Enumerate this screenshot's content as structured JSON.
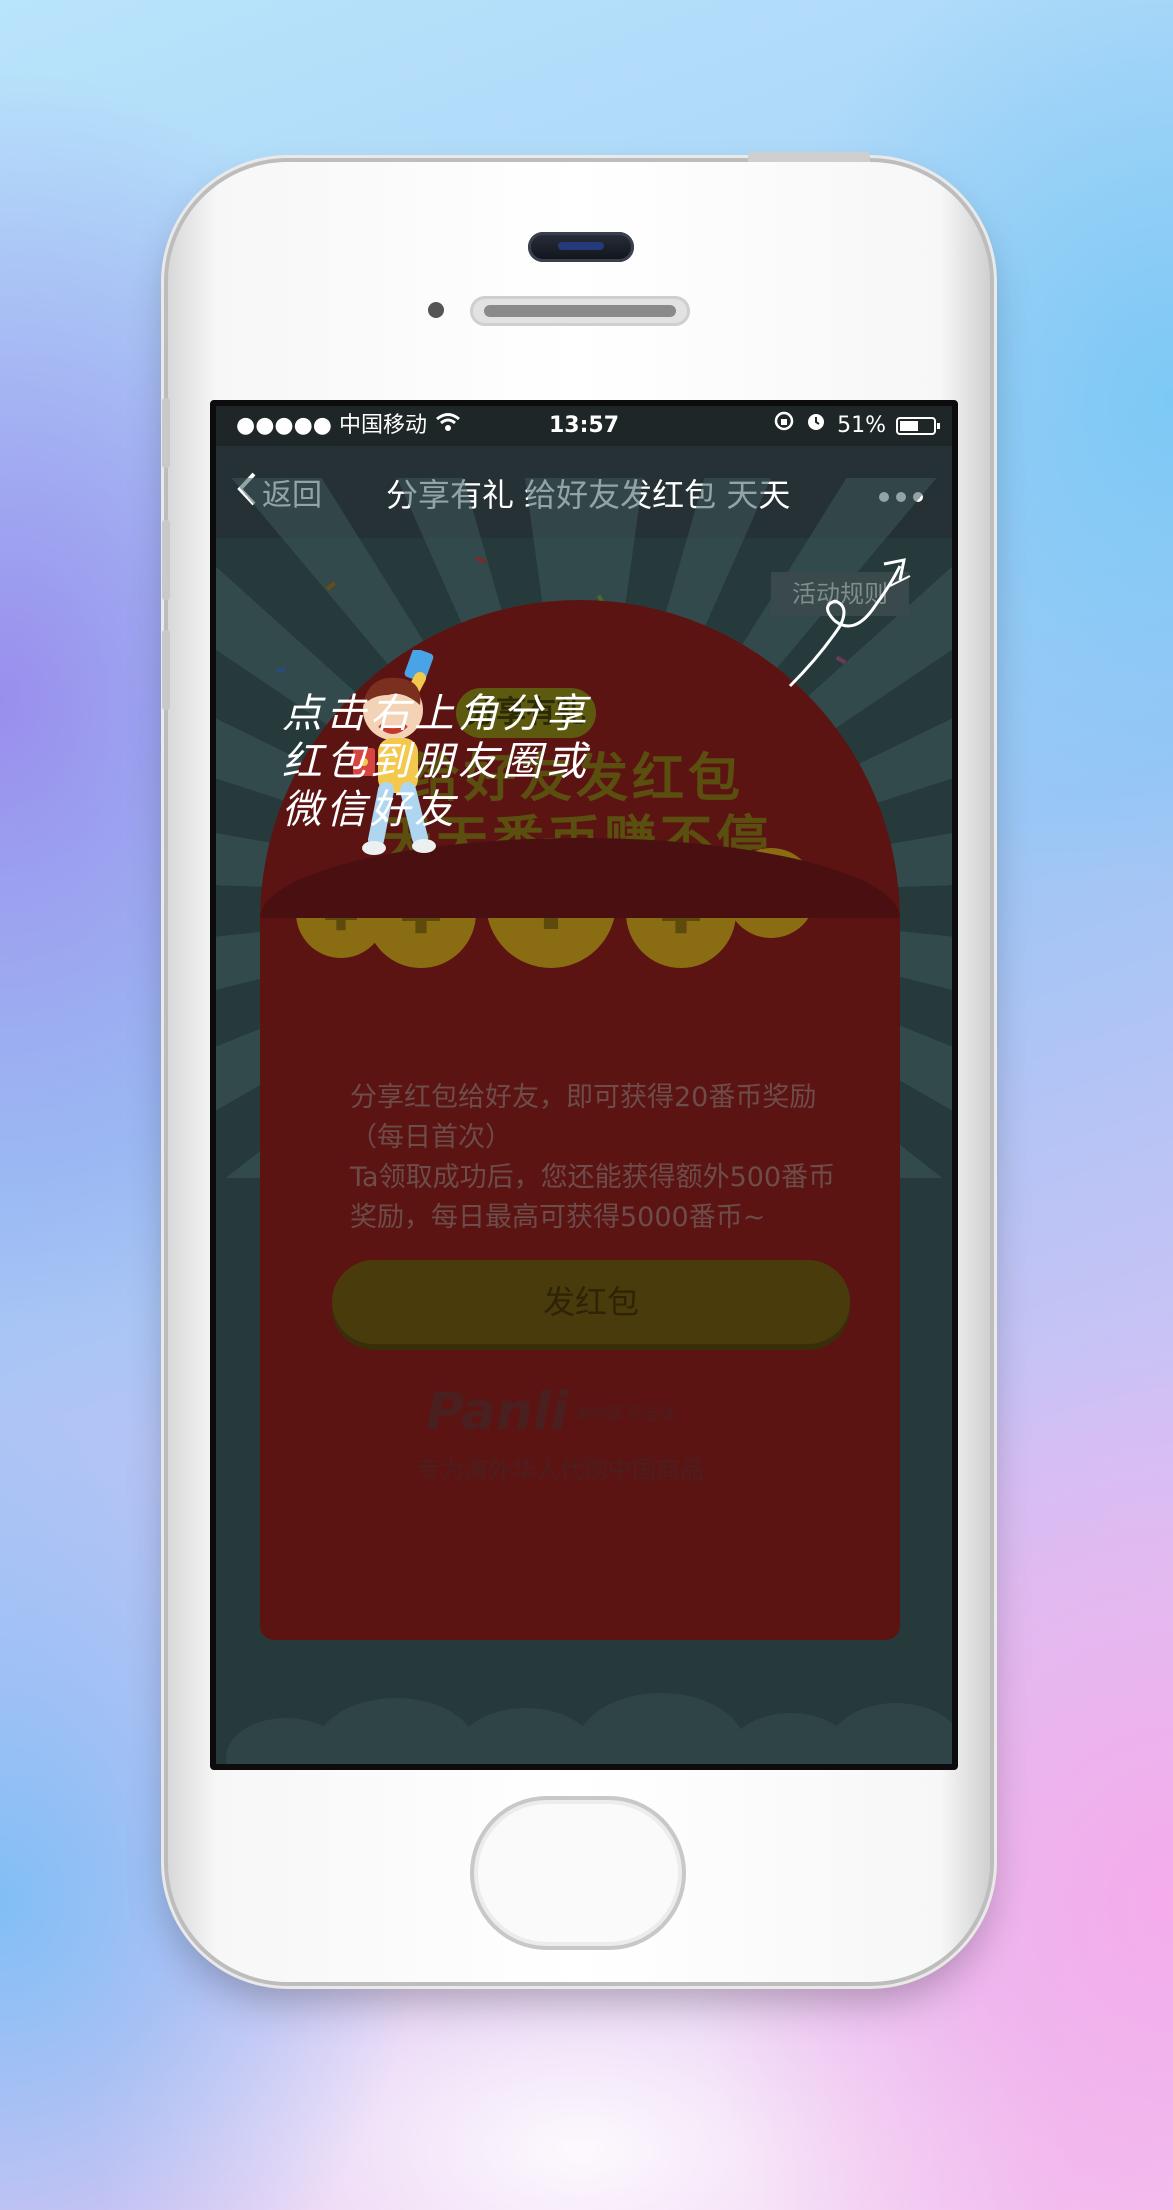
{
  "status_bar": {
    "carrier": "●●●●● 中国移动",
    "time": "13:57",
    "battery": "51%"
  },
  "nav": {
    "back_label": "返回",
    "title": "分享有礼 给好友发红包 天天",
    "more_label": "•••"
  },
  "page": {
    "rules_button": "活动规则",
    "badge_title": "分享有礼",
    "headline_line1": "给好友发红包",
    "headline_line2": "天天番币赚不停",
    "coin_symbol": "¥",
    "description": "分享红包给好友，即可获得20番币奖励（每日首次）\nTa领取成功后，您还能获得额外500番币奖励，每日最高可获得5000番币~",
    "send_button": "发红包",
    "brand_logo": "Panli",
    "brand_sub": "淘中国 买全球",
    "brand_tagline": "专为海外华人代购中国商品"
  },
  "guide_overlay": {
    "line1": "点击右上角分享",
    "line2": "红包到朋友圈或",
    "line3": "微信好友"
  },
  "colors": {
    "envelope": "#5c1413",
    "screen_dim": "#263a3c",
    "overlay_text": "#ffffff"
  }
}
